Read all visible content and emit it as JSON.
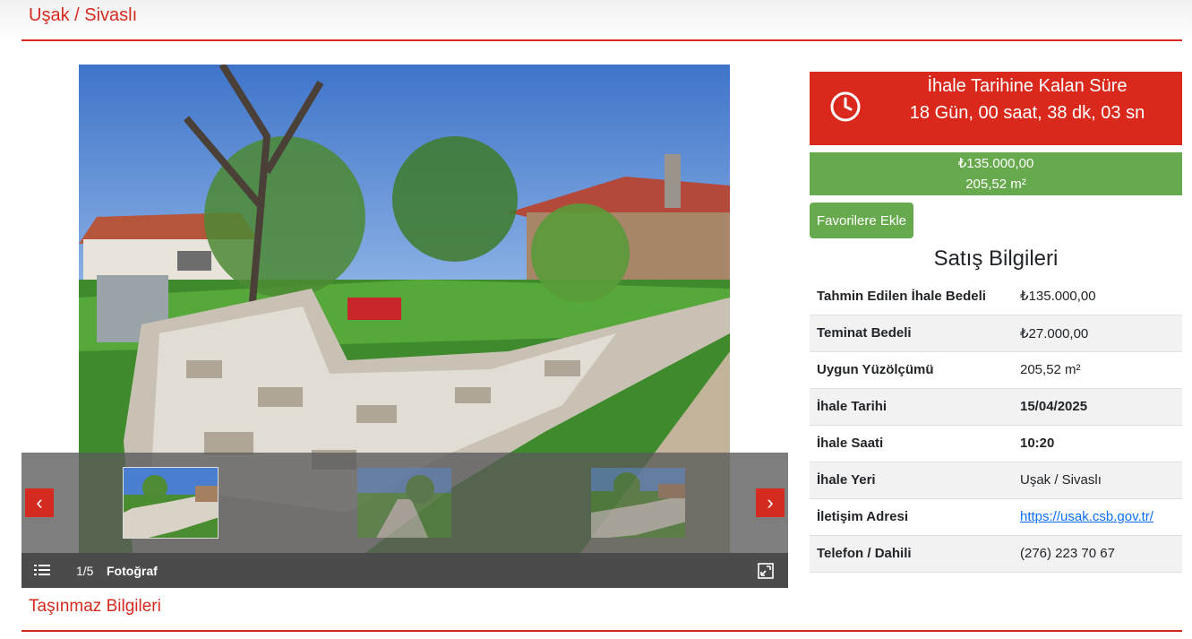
{
  "header": {
    "title": "Uşak / Sivaslı"
  },
  "gallery": {
    "counter": "1/5",
    "caption": "Fotoğraf",
    "prev_label": "‹",
    "next_label": "›"
  },
  "countdown": {
    "label": "İhale Tarihine Kalan Süre",
    "value": "18 Gün, 00 saat, 38 dk, 03 sn"
  },
  "price": {
    "amount": "₺135.000,00",
    "area": "205,52 m²"
  },
  "favorite_button": "Favorilere Ekle",
  "sales": {
    "title": "Satış Bilgileri",
    "rows": [
      {
        "label": "Tahmin Edilen İhale Bedeli",
        "value": "₺135.000,00"
      },
      {
        "label": "Teminat Bedeli",
        "value": "₺27.000,00"
      },
      {
        "label": "Uygun Yüzölçümü",
        "value": "205,52 m²"
      },
      {
        "label": "İhale Tarihi",
        "value": "15/04/2025"
      },
      {
        "label": "İhale Saati",
        "value": "10:20"
      },
      {
        "label": "İhale Yeri",
        "value": "Uşak / Sivaslı"
      },
      {
        "label": "İletişim Adresi",
        "value": "https://usak.csb.gov.tr/"
      },
      {
        "label": "Telefon / Dahili",
        "value": "(276) 223 70 67"
      }
    ]
  },
  "section": {
    "title": "Taşınmaz Bilgileri"
  },
  "colors": {
    "brand_red": "#da291c",
    "green": "#67a94d",
    "link": "#0d6efd"
  }
}
